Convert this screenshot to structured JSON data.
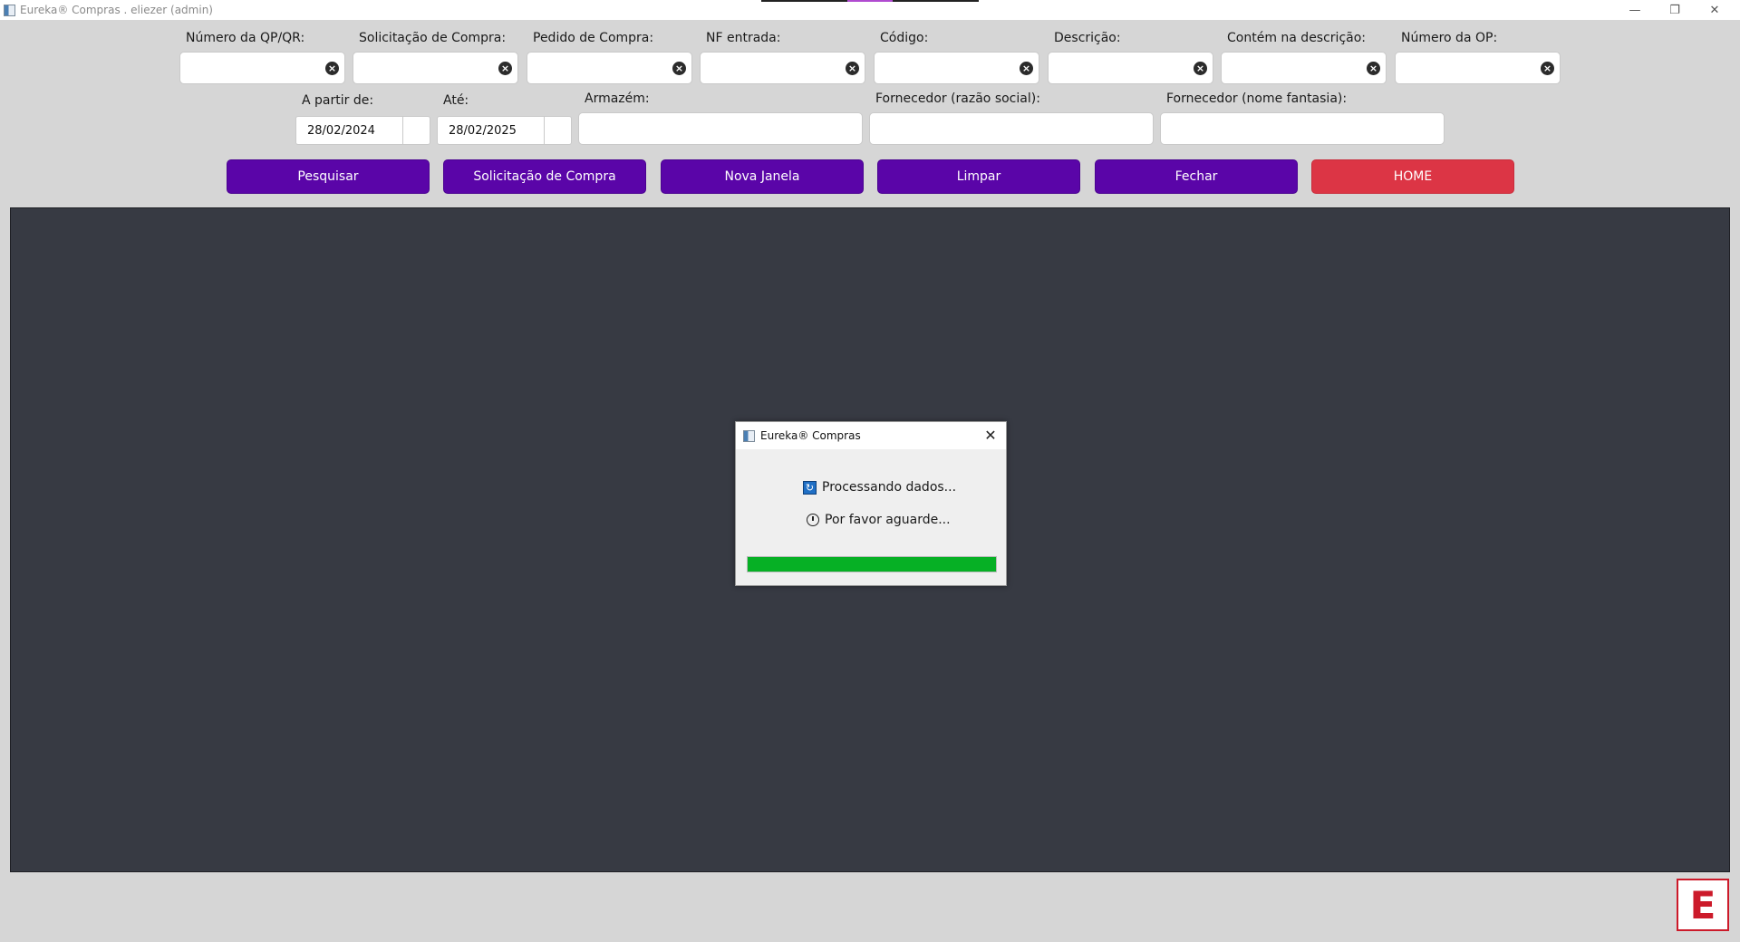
{
  "window": {
    "title": "Eureka® Compras . eliezer (admin)",
    "minimize_icon": "minimize-icon",
    "restore_icon": "restore-icon",
    "close_icon": "close-icon"
  },
  "filters": {
    "row1": [
      {
        "label": "Número da QP/QR:",
        "value": ""
      },
      {
        "label": "Solicitação de Compra:",
        "value": ""
      },
      {
        "label": "Pedido de Compra:",
        "value": ""
      },
      {
        "label": "NF entrada:",
        "value": ""
      },
      {
        "label": "Código:",
        "value": ""
      },
      {
        "label": "Descrição:",
        "value": ""
      },
      {
        "label": "Contém na descrição:",
        "value": ""
      },
      {
        "label": "Número da OP:",
        "value": ""
      }
    ],
    "date_from": {
      "label": "A partir de:",
      "value": "28/02/2024"
    },
    "date_to": {
      "label": "Até:",
      "value": "28/02/2025"
    },
    "armazem": {
      "label": "Armazém:",
      "value": ""
    },
    "fornecedor_razao": {
      "label": "Fornecedor (razão social):",
      "value": ""
    },
    "fornecedor_fantasia": {
      "label": "Fornecedor (nome fantasia):",
      "value": ""
    }
  },
  "buttons": {
    "pesquisar": "Pesquisar",
    "solicitacao": "Solicitação de Compra",
    "nova_janela": "Nova Janela",
    "limpar": "Limpar",
    "fechar": "Fechar",
    "home": "HOME"
  },
  "dialog": {
    "title": "Eureka® Compras",
    "line1": "Processando dados...",
    "line2": "Por favor aguarde...",
    "progress": 1.0
  },
  "logo": {
    "letter": "E"
  },
  "colors": {
    "button_primary": "#5a05a8",
    "button_home": "#dc3545",
    "panel": "#373a43",
    "progress": "#06b025",
    "logo": "#cc1a2a"
  }
}
